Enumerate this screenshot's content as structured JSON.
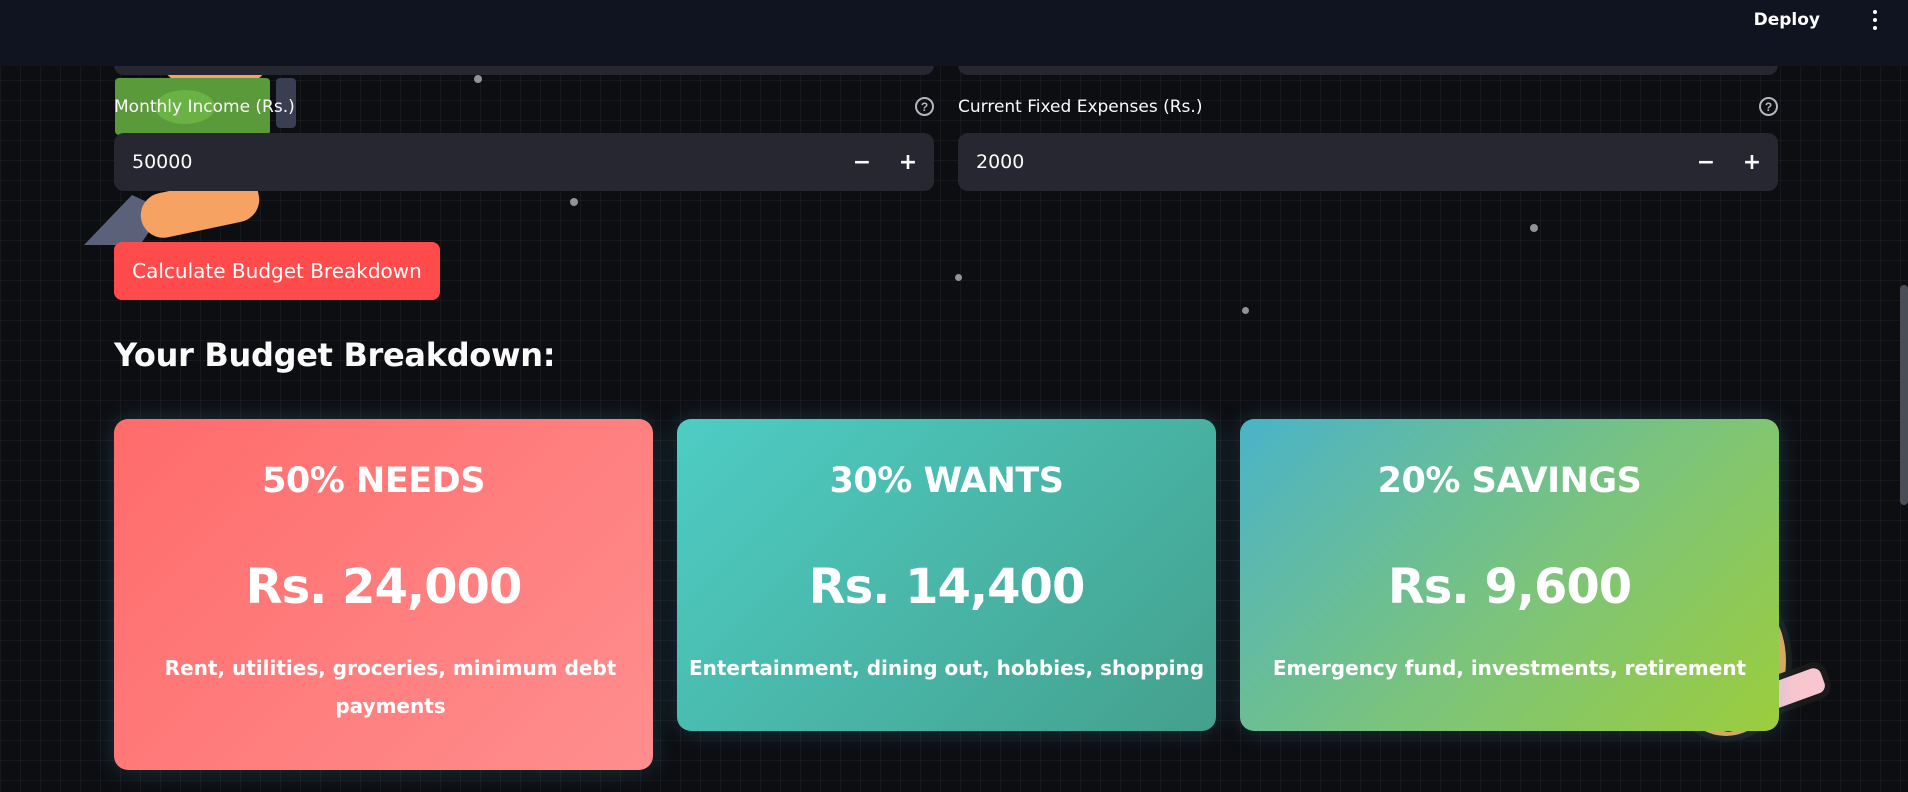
{
  "header": {
    "deploy_label": "Deploy",
    "menu_icon": "vertical-ellipsis-icon"
  },
  "form": {
    "income": {
      "label": "Monthly Income (Rs.)",
      "value": "50000",
      "minus": "−",
      "plus": "+",
      "help_icon": "?"
    },
    "expenses": {
      "label": "Current Fixed Expenses (Rs.)",
      "value": "2000",
      "minus": "−",
      "plus": "+",
      "help_icon": "?"
    },
    "submit_label": "Calculate Budget Breakdown"
  },
  "results": {
    "heading": "Your Budget Breakdown:",
    "cards": [
      {
        "title": "50% NEEDS",
        "amount": "Rs. 24,000",
        "description": "Rent, utilities, groceries, minimum debt payments"
      },
      {
        "title": "30% WANTS",
        "amount": "Rs. 14,400",
        "description": "Entertainment, dining out, hobbies, shopping"
      },
      {
        "title": "20% SAVINGS",
        "amount": "Rs. 9,600",
        "description": "Emergency fund, investments, retirement"
      }
    ]
  },
  "colors": {
    "background": "#0d0e12",
    "header": "#0f1420",
    "input_bg": "#262730",
    "primary_button": "#ff4b4b",
    "needs_gradient": [
      "#ff6b6b",
      "#ff8e8e"
    ],
    "wants_gradient": [
      "#4ecdc4",
      "#44a08d"
    ],
    "savings_gradient": [
      "#4ab3c8",
      "#9ccd3c"
    ]
  }
}
